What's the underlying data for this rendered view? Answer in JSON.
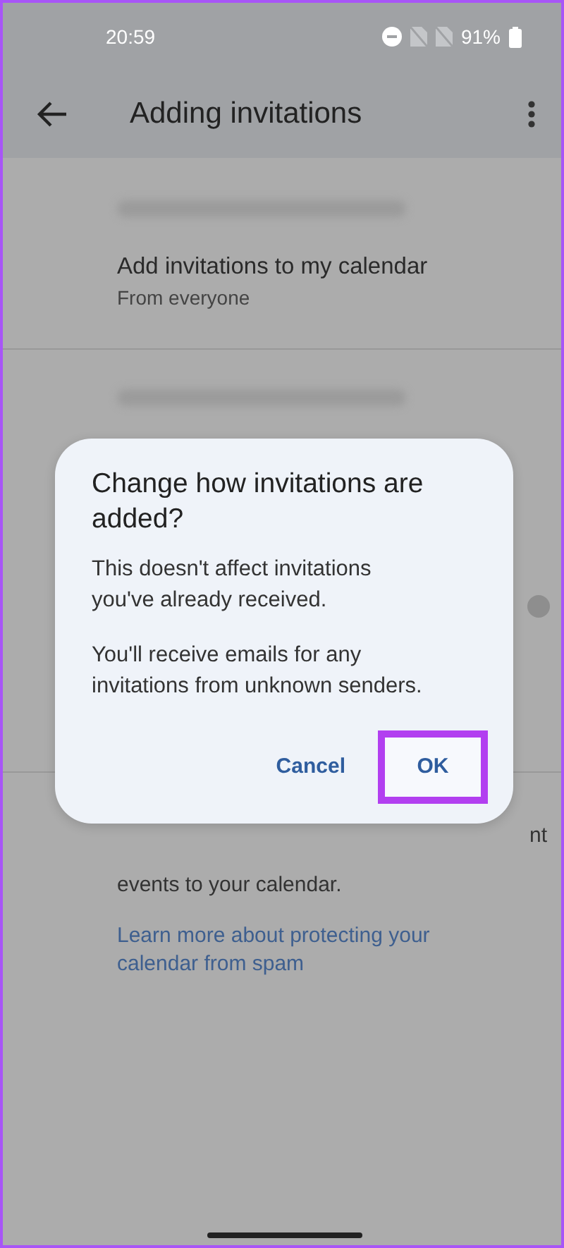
{
  "status_bar": {
    "time": "20:59",
    "battery": "91%"
  },
  "app_bar": {
    "title": "Adding invitations"
  },
  "settings": [
    {
      "kind": "redacted"
    },
    {
      "kind": "setting",
      "title": "Add invitations to my calendar",
      "subtitle": "From everyone"
    },
    {
      "kind": "divider"
    },
    {
      "kind": "redacted"
    },
    {
      "kind": "toggle",
      "on": false
    },
    {
      "kind": "divider"
    },
    {
      "kind": "tail",
      "text": "nt"
    },
    {
      "kind": "text",
      "text": "events to your calendar."
    },
    {
      "kind": "link",
      "text": "Learn more about protecting your calendar from spam"
    }
  ],
  "dialog": {
    "title": "Change how invitations are added?",
    "paragraphs": [
      "This doesn't affect invitations you've already received.",
      "You'll receive emails for any invitations from unknown senders."
    ],
    "buttons": [
      {
        "label": "Cancel",
        "highlighted": false
      },
      {
        "label": "OK",
        "highlighted": true
      }
    ]
  }
}
